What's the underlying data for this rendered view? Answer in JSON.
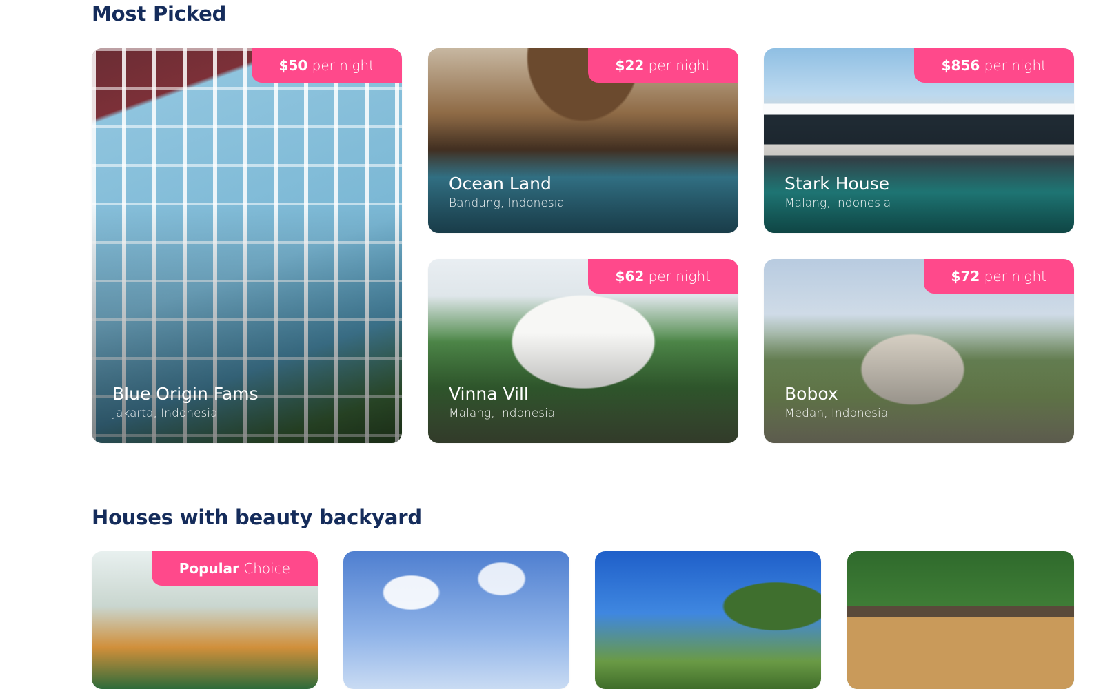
{
  "sections": {
    "most_picked": {
      "title": "Most Picked"
    },
    "backyard": {
      "title": "Houses with beauty backyard"
    }
  },
  "most_picked_cards": [
    {
      "name": "Blue Origin Fams",
      "location": "Jakarta, Indonesia",
      "price": "$50",
      "unit": "per night"
    },
    {
      "name": "Ocean Land",
      "location": "Bandung, Indonesia",
      "price": "$22",
      "unit": "per night"
    },
    {
      "name": "Stark House",
      "location": "Malang, Indonesia",
      "price": "$856",
      "unit": "per night"
    },
    {
      "name": "Vinna Vill",
      "location": "Malang, Indonesia",
      "price": "$62",
      "unit": "per night"
    },
    {
      "name": "Bobox",
      "location": "Medan, Indonesia",
      "price": "$72",
      "unit": "per night"
    }
  ],
  "backyard_badge": {
    "strong": "Popular",
    "rest": "Choice"
  },
  "colors": {
    "accent": "#ff498b",
    "heading": "#152c5b"
  }
}
